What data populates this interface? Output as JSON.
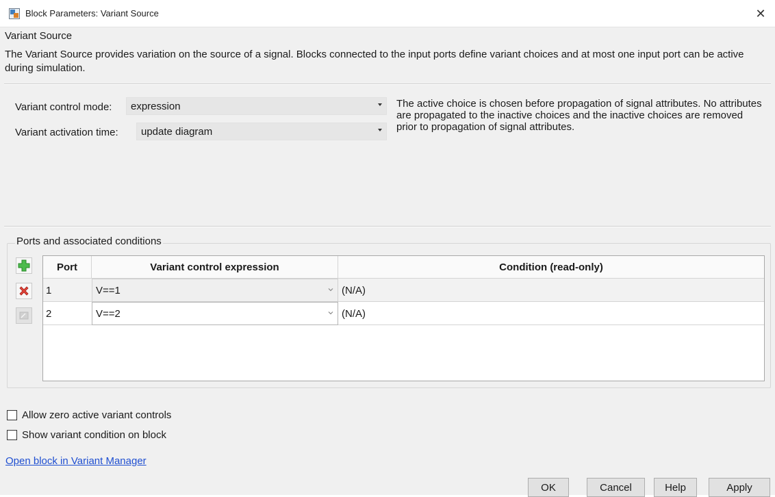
{
  "window": {
    "title": "Block Parameters: Variant Source",
    "close_glyph": "✕"
  },
  "header": {
    "block_name": "Variant Source",
    "description": "The Variant Source provides variation on the source of a signal. Blocks connected to the input ports define variant choices and at most one input port can be active during simulation."
  },
  "params": {
    "control_mode_label": "Variant control mode:",
    "control_mode_value": "expression",
    "activation_time_label": "Variant activation time:",
    "activation_time_value": "update diagram",
    "info": "The active choice is chosen before propagation of signal attributes. No attributes are propagated to the inactive choices and the inactive choices are removed prior to propagation of signal attributes."
  },
  "ports": {
    "group_label": "Ports and associated conditions",
    "columns": [
      "Port",
      "Variant control expression",
      "Condition (read-only)"
    ],
    "rows": [
      {
        "port": "1",
        "expression": "V==1",
        "condition": "(N/A)"
      },
      {
        "port": "2",
        "expression": "V==2",
        "condition": "(N/A)"
      }
    ],
    "icons": [
      "add-port-icon",
      "delete-port-icon",
      "disabled-action-icon"
    ]
  },
  "options": {
    "allow_zero_label": "Allow zero active variant controls",
    "allow_zero_checked": false,
    "show_condition_label": "Show variant condition on block",
    "show_condition_checked": false
  },
  "link_text": "Open block in Variant Manager",
  "buttons": {
    "ok": "OK",
    "cancel": "Cancel",
    "help": "Help",
    "apply": "Apply"
  },
  "colors": {
    "add_icon": "#3fae3f",
    "delete_icon": "#d9342b",
    "link": "#1f4fd1"
  }
}
